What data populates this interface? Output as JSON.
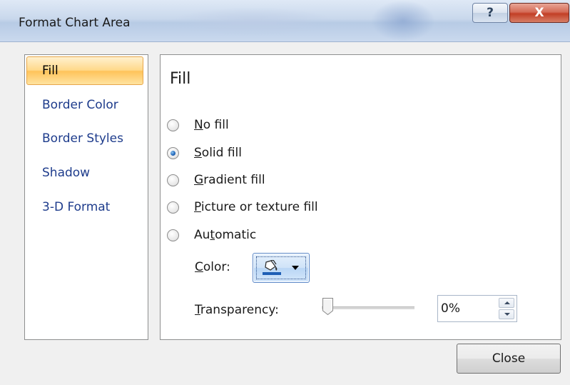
{
  "window": {
    "title": "Format Chart Area",
    "help_label": "?",
    "close_label": "X"
  },
  "nav": {
    "items": [
      {
        "label": "Fill",
        "active": true
      },
      {
        "label": "Border Color",
        "active": false
      },
      {
        "label": "Border Styles",
        "active": false
      },
      {
        "label": "Shadow",
        "active": false
      },
      {
        "label": "3-D Format",
        "active": false
      }
    ]
  },
  "fill_panel": {
    "title": "Fill",
    "options": [
      {
        "label": "No fill",
        "accel": "N",
        "rest": "o fill",
        "checked": false
      },
      {
        "label": "Solid fill",
        "accel": "S",
        "rest": "olid fill",
        "checked": true
      },
      {
        "label": "Gradient fill",
        "accel": "G",
        "rest": "radient fill",
        "checked": false
      },
      {
        "label": "Picture or texture fill",
        "accel": "P",
        "rest": "icture or texture fill",
        "checked": false
      },
      {
        "label": "Automatic",
        "accel_pre": "Au",
        "accel": "t",
        "rest": "omatic",
        "checked": false
      }
    ],
    "color": {
      "label_accel": "C",
      "label_rest": "olor:",
      "icon": "paint-bucket-icon",
      "swatch_color": "#1f5fb5"
    },
    "transparency": {
      "label_accel": "T",
      "label_rest": "ransparency:",
      "level_percent": 0,
      "value": "0%"
    }
  },
  "footer": {
    "close_label": "Close"
  }
}
